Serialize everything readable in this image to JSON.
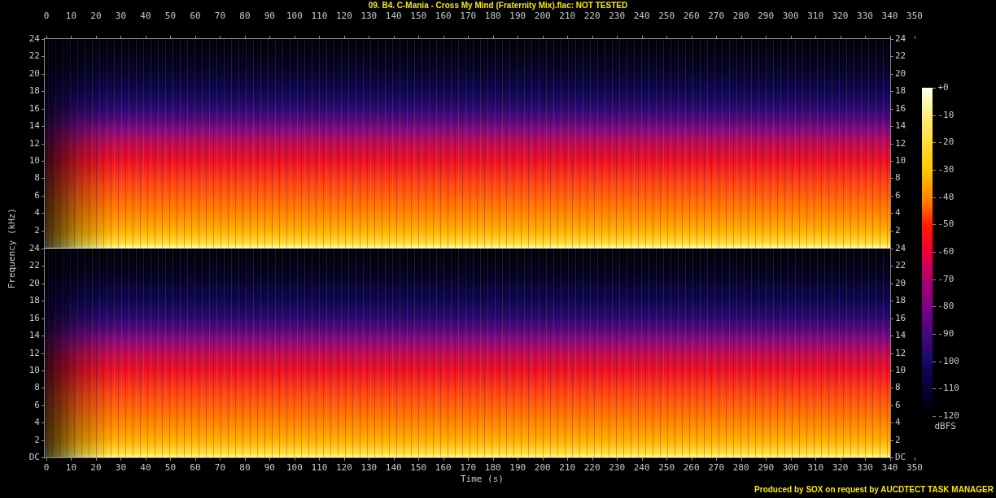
{
  "title": "09. B4. C-Mania - Cross My Mind (Fraternity Mix).flac: NOT TESTED",
  "x_axis_top": {
    "ticks": [
      "0",
      "10",
      "20",
      "30",
      "40",
      "50",
      "60",
      "70",
      "80",
      "90",
      "100",
      "110",
      "120",
      "130",
      "140",
      "150",
      "160",
      "170",
      "180",
      "190",
      "200",
      "210",
      "220",
      "230",
      "240",
      "250",
      "260",
      "270",
      "280",
      "290",
      "300",
      "310",
      "320",
      "330",
      "340",
      "350"
    ]
  },
  "y_axis": {
    "label": "Frequency (kHz)"
  },
  "channels": [
    {
      "left_ticks": [
        "24",
        "22",
        "20",
        "18",
        "16",
        "14",
        "12",
        "10",
        "8",
        "6",
        "4",
        "2"
      ],
      "right_ticks": [
        "24",
        "22",
        "20",
        "18",
        "16",
        "14",
        "12",
        "10",
        "8",
        "6",
        "4",
        "2"
      ]
    },
    {
      "left_ticks": [
        "24",
        "22",
        "20",
        "18",
        "16",
        "14",
        "12",
        "10",
        "8",
        "6",
        "4",
        "2",
        "DC"
      ],
      "right_ticks": [
        "24",
        "22",
        "20",
        "18",
        "16",
        "14",
        "12",
        "10",
        "8",
        "6",
        "4",
        "2",
        "DC"
      ]
    }
  ],
  "color_scale": {
    "ticks": [
      "+0",
      "-10",
      "-20",
      "-30",
      "-40",
      "-50",
      "-60",
      "-70",
      "-80",
      "-90",
      "-100",
      "-110",
      "-120"
    ],
    "unit": "dBFS"
  },
  "x_axis_bottom": {
    "ticks": [
      "0",
      "10",
      "20",
      "30",
      "40",
      "50",
      "60",
      "70",
      "80",
      "90",
      "100",
      "110",
      "120",
      "130",
      "140",
      "150",
      "160",
      "170",
      "180",
      "190",
      "200",
      "210",
      "220",
      "230",
      "240",
      "250",
      "260",
      "270",
      "280",
      "290",
      "300",
      "310",
      "320",
      "330",
      "340",
      "350"
    ],
    "label": "Time (s)"
  },
  "footer": "Produced by SOX on request by AUCDTECT TASK MANAGER"
}
